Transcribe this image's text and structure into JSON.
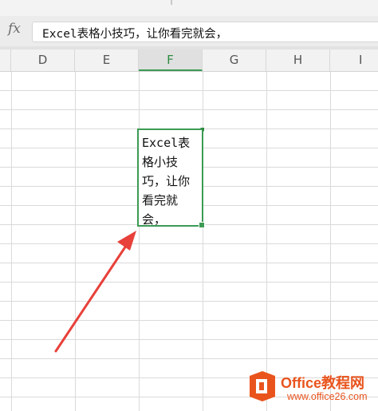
{
  "formula_bar": {
    "fx_label": "fx",
    "content": "Excel表格小技巧，让你看完就会，"
  },
  "columns": [
    "D",
    "E",
    "F",
    "G",
    "H",
    "I"
  ],
  "active_column": "F",
  "active_cell": {
    "text": "Excel表格小技巧，让你看完就会，"
  },
  "watermark": {
    "title": "Office教程网",
    "url": "www.office26.com"
  },
  "colors": {
    "accent_green": "#3c9b54",
    "arrow_red": "#e8403a",
    "watermark_orange": "#e9541d"
  }
}
